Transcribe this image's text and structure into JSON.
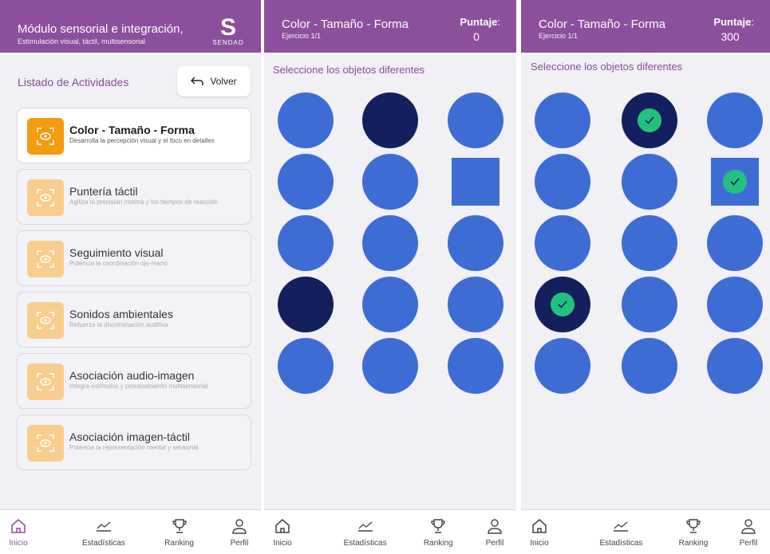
{
  "screen1": {
    "header": {
      "title": "Módulo sensorial e integración,",
      "subtitle": "Estimulación visual, táctil, multisensorial",
      "logo_text": "SENDAD"
    },
    "list_title": "Listado de Actividades",
    "back_label": "Volver",
    "activities": [
      {
        "title": "Color - Tamaño - Forma",
        "desc": "Desarrolla la percepción visual y el foco en detalles"
      },
      {
        "title": "Puntería táctil",
        "desc": "Agiliza la precisión motora y los tiempos de reacción"
      },
      {
        "title": "Seguimiento visual",
        "desc": "Potencia la coordinación ojo-mano"
      },
      {
        "title": "Sonidos ambientales",
        "desc": "Refuerza la discriminación auditiva"
      },
      {
        "title": "Asociación audio-imagen",
        "desc": "Integra estímulos y procesamiento multisensorial"
      },
      {
        "title": "Asociación imagen-táctil",
        "desc": "Potencia la representación mental y sensorial"
      }
    ]
  },
  "exercise": {
    "title": "Color - Tamaño - Forma",
    "subtitle": "Ejercicio 1/1",
    "score_label": "Puntaje",
    "score_colon": ":",
    "instruction": "Seleccione los objetos diferentes"
  },
  "screen2": {
    "score": "0"
  },
  "screen3": {
    "score": "300"
  },
  "grid": [
    {
      "shape": "circle",
      "tone": "normal",
      "selected": false
    },
    {
      "shape": "circle",
      "tone": "dark",
      "selected": true
    },
    {
      "shape": "circle",
      "tone": "normal",
      "selected": false
    },
    {
      "shape": "circle",
      "tone": "normal",
      "selected": false
    },
    {
      "shape": "circle",
      "tone": "normal",
      "selected": false
    },
    {
      "shape": "square",
      "tone": "normal",
      "selected": true
    },
    {
      "shape": "circle",
      "tone": "normal",
      "selected": false
    },
    {
      "shape": "circle",
      "tone": "normal",
      "selected": false
    },
    {
      "shape": "circle",
      "tone": "normal",
      "selected": false
    },
    {
      "shape": "circle",
      "tone": "dark",
      "selected": true
    },
    {
      "shape": "circle",
      "tone": "normal",
      "selected": false
    },
    {
      "shape": "circle",
      "tone": "normal",
      "selected": false
    },
    {
      "shape": "circle",
      "tone": "normal",
      "selected": false
    },
    {
      "shape": "circle",
      "tone": "normal",
      "selected": false
    },
    {
      "shape": "circle",
      "tone": "normal",
      "selected": false
    }
  ],
  "nav": [
    {
      "label": "Inicio",
      "icon": "home-icon"
    },
    {
      "label": "Estadísticas",
      "icon": "chart-icon"
    },
    {
      "label": "Ranking",
      "icon": "trophy-icon"
    },
    {
      "label": "Perfil",
      "icon": "user-icon"
    }
  ],
  "colors": {
    "header": "#8c4f9b",
    "object": "#3d6dd4",
    "object_dark": "#13205d",
    "check": "#24c17e",
    "activity_icon": "#f49b12"
  }
}
